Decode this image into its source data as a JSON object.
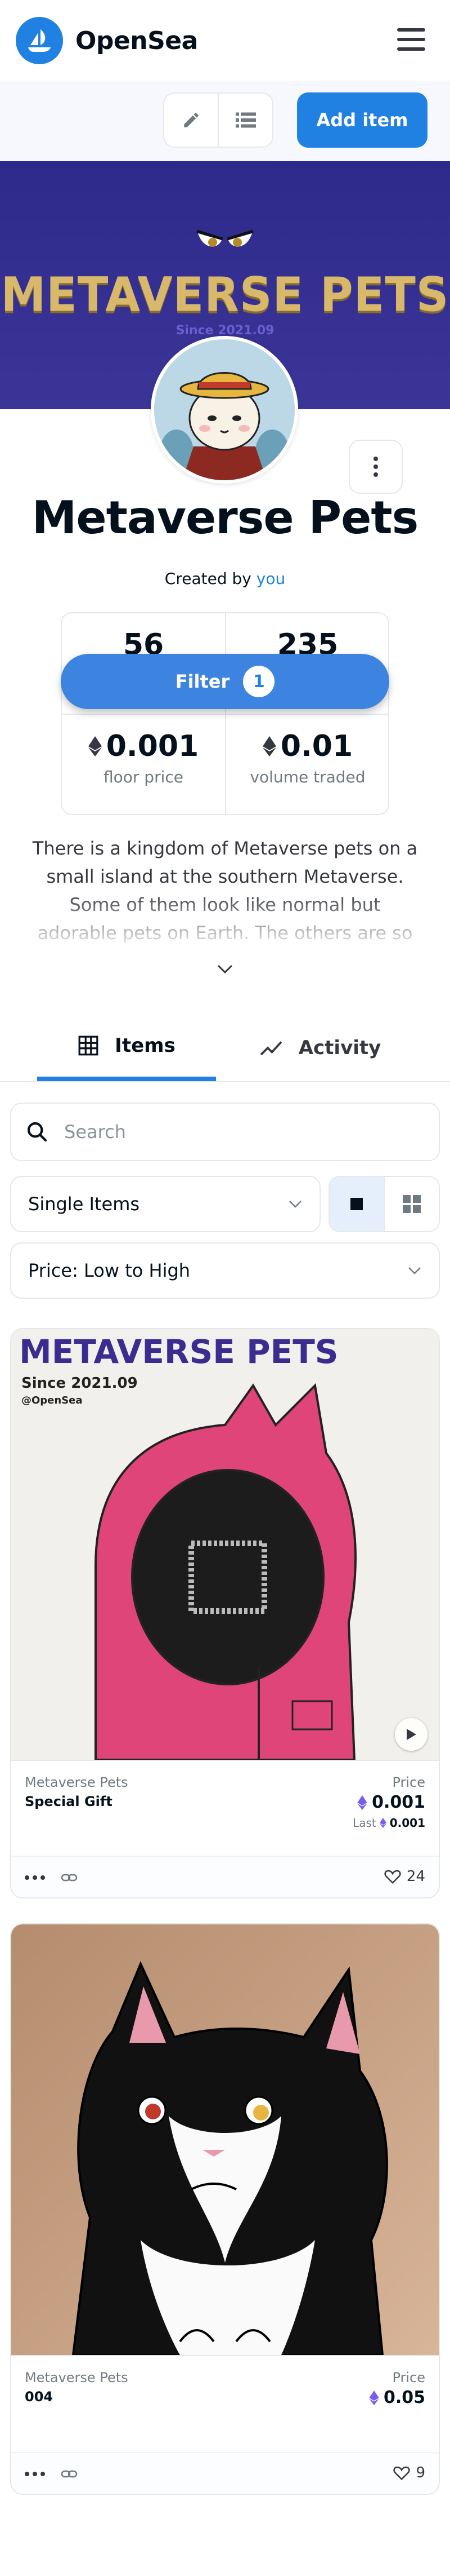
{
  "header": {
    "brand": "OpenSea",
    "menu_icon": "hamburger-menu-icon"
  },
  "actionbar": {
    "edit_icon": "pencil-icon",
    "list_icon": "list-icon",
    "add_item_label": "Add item"
  },
  "banner": {
    "title": "METAVERSE PETS",
    "subtitle": "Since 2021.09"
  },
  "collection": {
    "name": "Metaverse Pets",
    "created_prefix": "Created by",
    "creator": "you",
    "description": "There is a kingdom of Metaverse pets on a small island at the southern Metaverse. Some of them look like normal but adorable pets on Earth. The others are so different and out of our imagination. They are live"
  },
  "stats": {
    "items": "56",
    "owners": "235",
    "floor_price": "0.001",
    "floor_label": "floor price",
    "volume": "0.01",
    "volume_label": "volume traded"
  },
  "filter": {
    "label": "Filter",
    "count": "1"
  },
  "tabs": [
    {
      "label": "Items",
      "icon": "grid-icon",
      "active": true
    },
    {
      "label": "Activity",
      "icon": "activity-chart-icon",
      "active": false
    }
  ],
  "search": {
    "placeholder": "Search"
  },
  "filters": {
    "type_value": "Single Items",
    "sort_value": "Price: Low to High"
  },
  "cards": [
    {
      "image_title": "METAVERSE PETS",
      "image_sub": "Since 2021.09",
      "image_handle": "@OpenSea",
      "collection": "Metaverse Pets",
      "name": "Special Gift",
      "price_label": "Price",
      "price": "0.001",
      "last_label": "Last",
      "last_price": "0.001",
      "likes": "24"
    },
    {
      "collection": "Metaverse Pets",
      "name": "004",
      "price_label": "Price",
      "price": "0.05",
      "likes": "9"
    }
  ],
  "colors": {
    "accent": "#2081e2",
    "banner": "#2d2a8c",
    "text": "#04111d",
    "muted": "#707a83",
    "eth": "#7b5cf0"
  }
}
